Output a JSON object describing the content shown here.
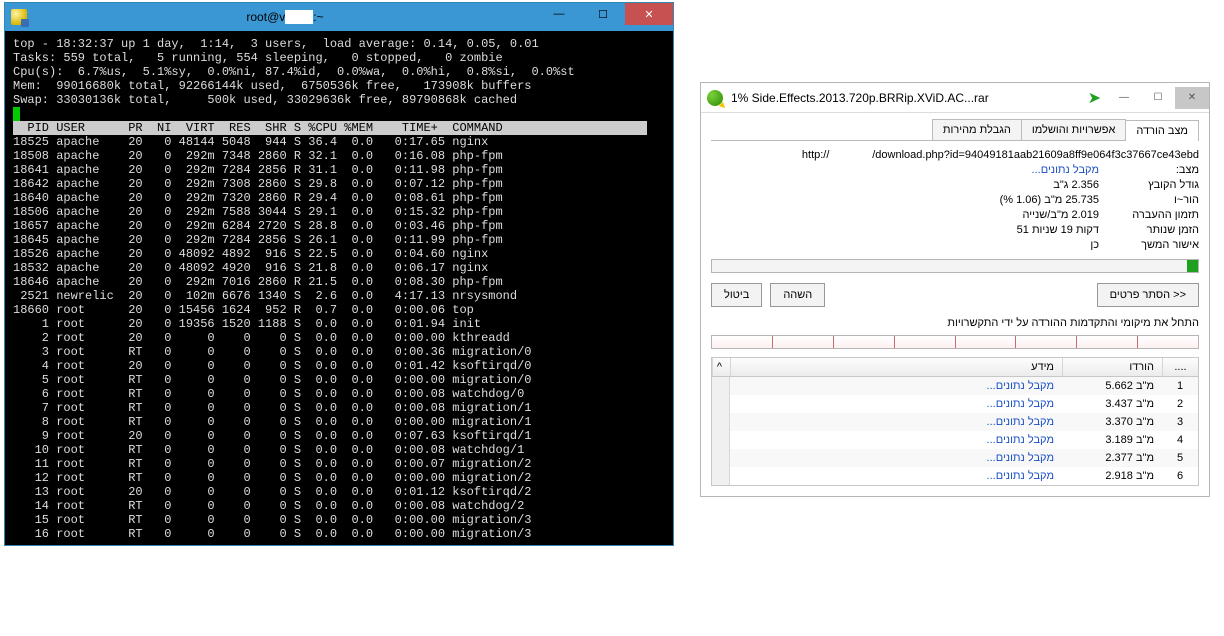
{
  "putty": {
    "title_prefix": "root@v",
    "title_suffix": ":~",
    "summary": [
      "top - 18:32:37 up 1 day,  1:14,  3 users,  load average: 0.14, 0.05, 0.01",
      "Tasks: 559 total,   5 running, 554 sleeping,   0 stopped,   0 zombie",
      "Cpu(s):  6.7%us,  5.1%sy,  0.0%ni, 87.4%id,  0.0%wa,  0.0%hi,  0.8%si,  0.0%st",
      "Mem:  99016680k total, 92266144k used,  6750536k free,   173908k buffers",
      "Swap: 33030136k total,     500k used, 33029636k free, 89790868k cached"
    ],
    "header": "  PID USER      PR  NI  VIRT  RES  SHR S %CPU %MEM    TIME+  COMMAND",
    "rows": [
      "18525 apache    20   0 48144 5048  944 S 36.4  0.0   0:17.65 nginx",
      "18508 apache    20   0  292m 7348 2860 R 32.1  0.0   0:16.08 php-fpm",
      "18641 apache    20   0  292m 7284 2856 R 31.1  0.0   0:11.98 php-fpm",
      "18642 apache    20   0  292m 7308 2860 S 29.8  0.0   0:07.12 php-fpm",
      "18640 apache    20   0  292m 7320 2860 R 29.4  0.0   0:08.61 php-fpm",
      "18506 apache    20   0  292m 7588 3044 S 29.1  0.0   0:15.32 php-fpm",
      "18657 apache    20   0  292m 6284 2720 S 28.8  0.0   0:03.46 php-fpm",
      "18645 apache    20   0  292m 7284 2856 S 26.1  0.0   0:11.99 php-fpm",
      "18526 apache    20   0 48092 4892  916 S 22.5  0.0   0:04.60 nginx",
      "18532 apache    20   0 48092 4920  916 S 21.8  0.0   0:06.17 nginx",
      "18646 apache    20   0  292m 7016 2860 R 21.5  0.0   0:08.30 php-fpm",
      " 2521 newrelic  20   0  102m 6676 1340 S  2.6  0.0   4:17.13 nrsysmond",
      "18660 root      20   0 15456 1624  952 R  0.7  0.0   0:00.06 top",
      "    1 root      20   0 19356 1520 1188 S  0.0  0.0   0:01.94 init",
      "    2 root      20   0     0    0    0 S  0.0  0.0   0:00.00 kthreadd",
      "    3 root      RT   0     0    0    0 S  0.0  0.0   0:00.36 migration/0",
      "    4 root      20   0     0    0    0 S  0.0  0.0   0:01.42 ksoftirqd/0",
      "    5 root      RT   0     0    0    0 S  0.0  0.0   0:00.00 migration/0",
      "    6 root      RT   0     0    0    0 S  0.0  0.0   0:00.08 watchdog/0",
      "    7 root      RT   0     0    0    0 S  0.0  0.0   0:00.08 migration/1",
      "    8 root      RT   0     0    0    0 S  0.0  0.0   0:00.00 migration/1",
      "    9 root      20   0     0    0    0 S  0.0  0.0   0:07.63 ksoftirqd/1",
      "   10 root      RT   0     0    0    0 S  0.0  0.0   0:00.08 watchdog/1",
      "   11 root      RT   0     0    0    0 S  0.0  0.0   0:00.07 migration/2",
      "   12 root      RT   0     0    0    0 S  0.0  0.0   0:00.00 migration/2",
      "   13 root      20   0     0    0    0 S  0.0  0.0   0:01.12 ksoftirqd/2",
      "   14 root      RT   0     0    0    0 S  0.0  0.0   0:00.08 watchdog/2",
      "   15 root      RT   0     0    0    0 S  0.0  0.0   0:00.00 migration/3",
      "   16 root      RT   0     0    0    0 S  0.0  0.0   0:00.00 migration/3"
    ]
  },
  "idm": {
    "title": "1% Side.Effects.2013.720p.BRRip.XViD.AC...rar",
    "tabs": {
      "t1": "מצב הורדה",
      "t2": "אפשרויות והושלמו",
      "t3": "הגבלת מהירות"
    },
    "url_prefix": "http://",
    "url_rest": "/download.php?id=94049181aab21609a8ff9e064f3c37667ce43ebd",
    "rows": {
      "status_lbl": "מצב:",
      "status_val": "מקבל נתונים...",
      "size_lbl": "גודל הקובץ",
      "size_val": "2.356      ג\"ב",
      "downloaded_lbl": "הור~ו",
      "downloaded_val": "25.735    מ\"ב  (1.06 %)",
      "speed_lbl": "תזמון ההעברה",
      "speed_val": "2.019      מ\"ב/שנייה",
      "time_lbl": "הזמן שנותר",
      "time_val": "דקות 19 שניות 51",
      "resume_lbl": "אישור המשך",
      "resume_val": "כן"
    },
    "buttons": {
      "details": "<< הסתר פרטים",
      "pause": "השהה",
      "cancel": "ביטול"
    },
    "msg": "התחל את מיקומי והתקדמות ההורדה על ידי התקשרויות",
    "table": {
      "h_num": "....",
      "h_dl": "הורדו",
      "h_info": "מידע",
      "rows": [
        {
          "n": "1",
          "dl": "5.662    מ\"ב",
          "info": "מקבל נתונים..."
        },
        {
          "n": "2",
          "dl": "3.437    מ\"ב",
          "info": "מקבל נתונים..."
        },
        {
          "n": "3",
          "dl": "3.370    מ\"ב",
          "info": "מקבל נתונים..."
        },
        {
          "n": "4",
          "dl": "3.189    מ\"ב",
          "info": "מקבל נתונים..."
        },
        {
          "n": "5",
          "dl": "2.377    מ\"ב",
          "info": "מקבל נתונים..."
        },
        {
          "n": "6",
          "dl": "2.918    מ\"ב",
          "info": "מקבל נתונים..."
        }
      ]
    }
  }
}
